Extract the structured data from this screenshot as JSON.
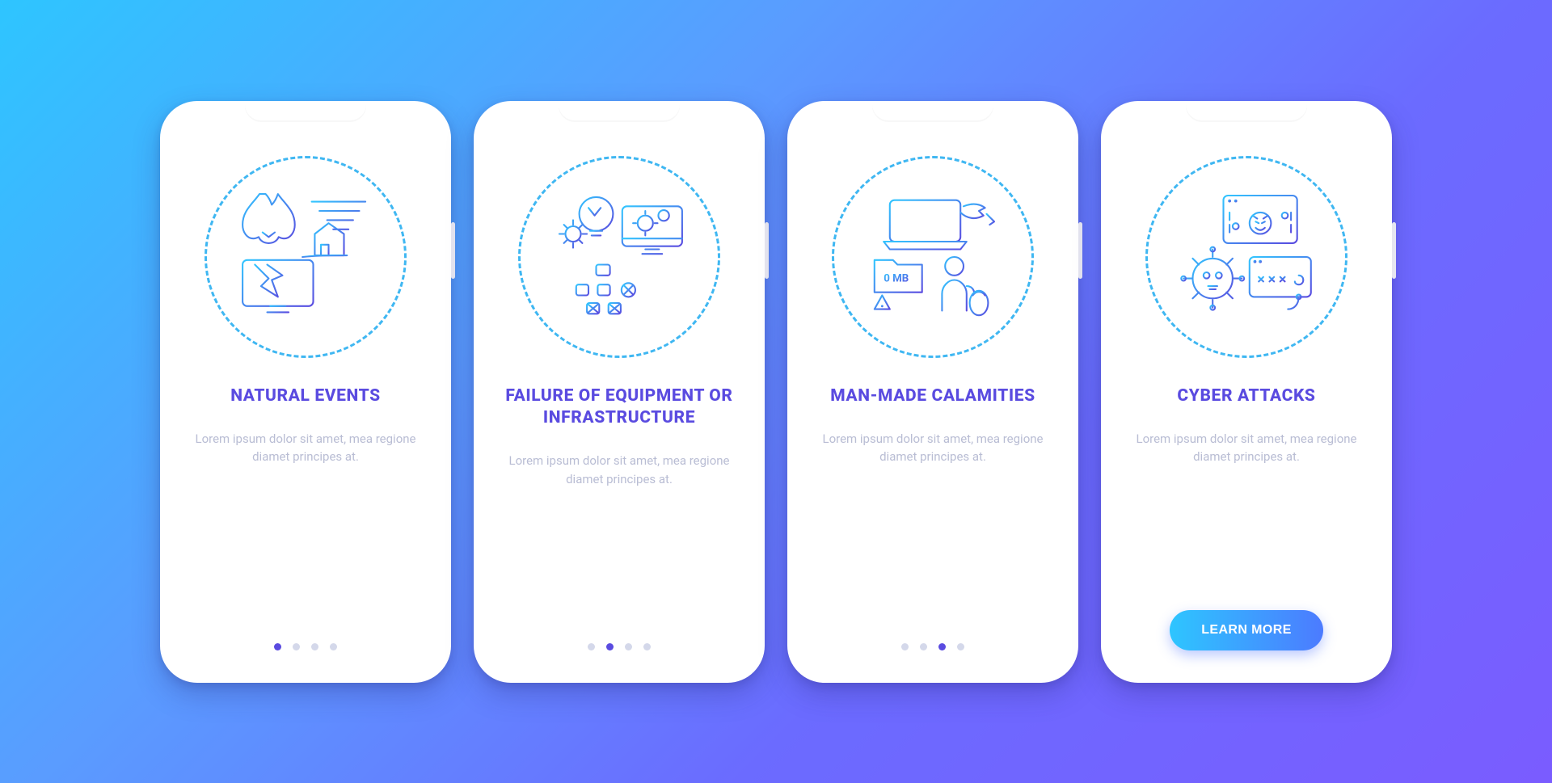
{
  "cards": [
    {
      "icon": "natural-events-icon",
      "title": "NATURAL EVENTS",
      "description": "Lorem ipsum dolor sit amet, mea regione diamet principes at.",
      "active_dot": 0,
      "has_cta": false
    },
    {
      "icon": "equipment-failure-icon",
      "title": "FAILURE OF EQUIPMENT OR INFRASTRUCTURE",
      "description": "Lorem ipsum dolor sit amet, mea regione diamet principes at.",
      "active_dot": 1,
      "has_cta": false
    },
    {
      "icon": "man-made-calamities-icon",
      "title": "MAN-MADE CALAMITIES",
      "description": "Lorem ipsum dolor sit amet, mea regione diamet principes at.",
      "active_dot": 2,
      "has_cta": false
    },
    {
      "icon": "cyber-attacks-icon",
      "title": "CYBER ATTACKS",
      "description": "Lorem ipsum dolor sit amet, mea regione diamet principes at.",
      "active_dot": 3,
      "has_cta": true
    }
  ],
  "cta_label": "LEARN MORE",
  "dot_count": 4,
  "colors": {
    "bg_gradient_start": "#2ec5ff",
    "bg_gradient_end": "#7a5cff",
    "title": "#5a4be0",
    "desc": "#b9bdd4",
    "dot_inactive": "#d4d8ea",
    "dot_active": "#5a4be0",
    "icon_stroke_start": "#32c6ff",
    "icon_stroke_end": "#5a4be0"
  },
  "zero_mb_label": "0 MB"
}
